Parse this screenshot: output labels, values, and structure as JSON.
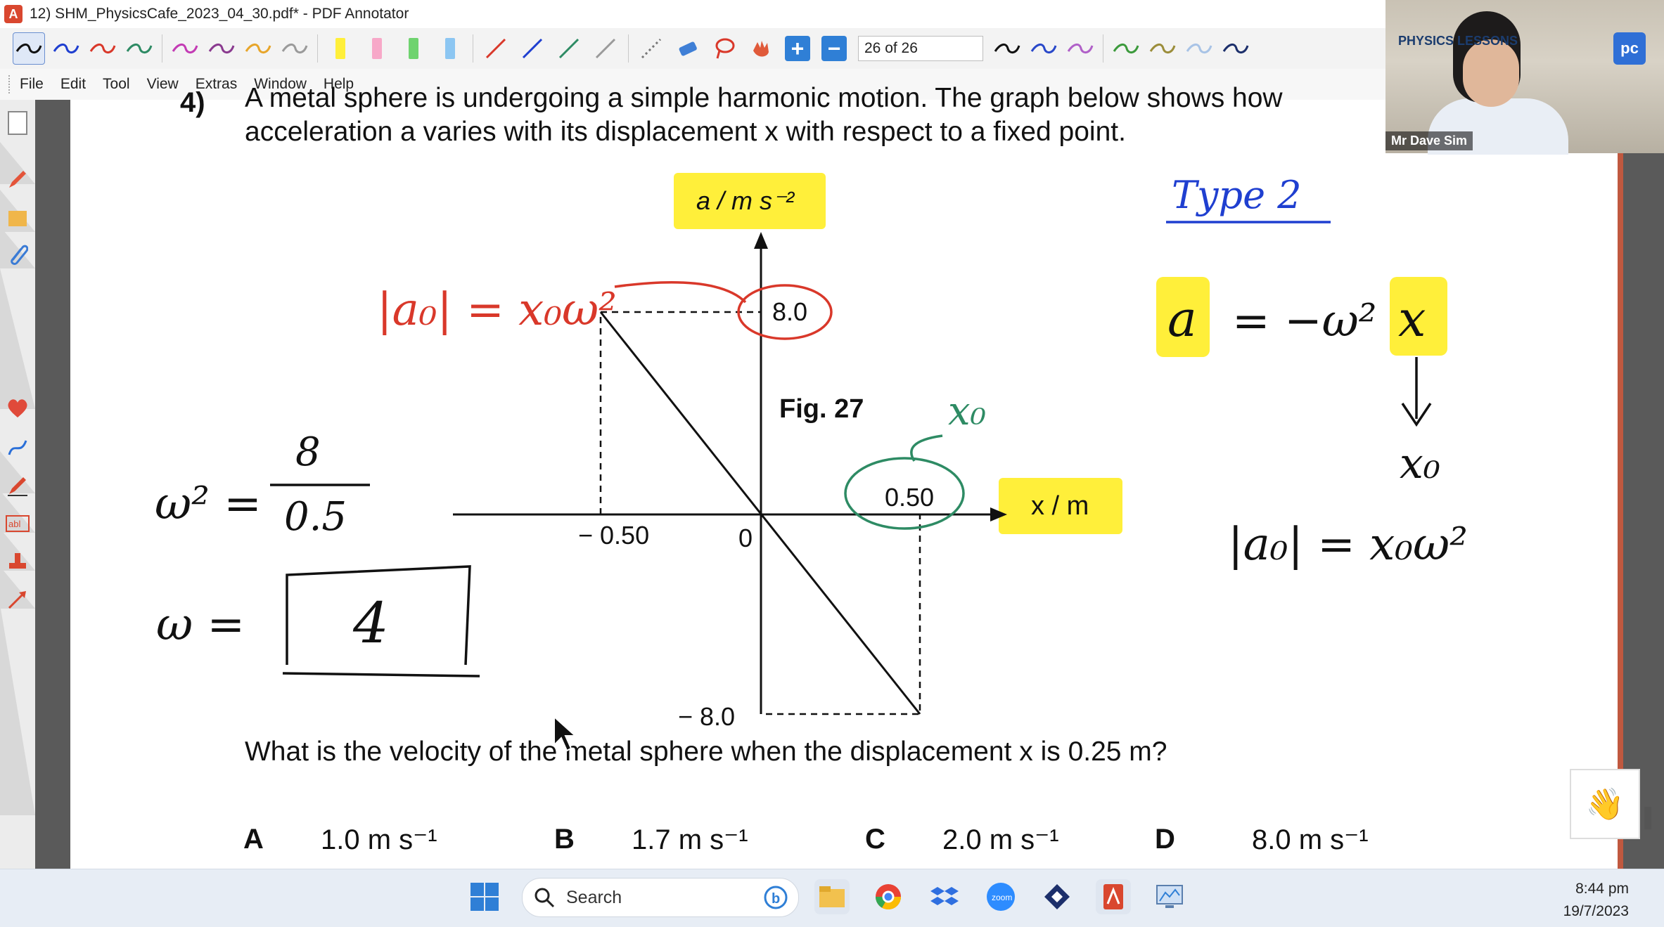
{
  "window": {
    "title": "12) SHM_PhysicsCafe_2023_04_30.pdf* - PDF Annotator"
  },
  "toolbar": {
    "page_indicator": "26 of 26",
    "zoom_in": "+",
    "zoom_out": "−"
  },
  "menu": [
    "File",
    "Edit",
    "Tool",
    "View",
    "Extras",
    "Window",
    "Help"
  ],
  "document": {
    "question_number": "4)",
    "question_line1": "A metal sphere is undergoing a simple harmonic motion. The graph below shows how",
    "question_line2": "acceleration a varies with its displacement x with respect to a fixed point.",
    "figure_caption": "Fig. 27",
    "y_axis_label": "a / m s⁻²",
    "x_axis_label": "x / m",
    "tick_y_top": "8.0",
    "tick_y_bottom": "− 8.0",
    "tick_x_left": "− 0.50",
    "tick_x_right": "0.50",
    "origin": "0",
    "question_bottom": "What is the velocity of the metal sphere when the displacement x is 0.25 m?",
    "options": [
      {
        "letter": "A",
        "value": "1.0 m s⁻¹"
      },
      {
        "letter": "B",
        "value": "1.7 m s⁻¹"
      },
      {
        "letter": "C",
        "value": "2.0 m s⁻¹"
      },
      {
        "letter": "D",
        "value": "8.0 m s⁻¹"
      }
    ]
  },
  "handwriting": {
    "red_formula": "|a₀| = x₀ω²",
    "green_label": "x₀",
    "omega_sq": "ω² =",
    "fraction_num": "8",
    "fraction_den": "0.5",
    "omega_eq": "ω =",
    "omega_value": "4",
    "type_label": "Type 2",
    "eq_a": "a",
    "eq_rest": "= −ω²",
    "eq_x": "x",
    "x0": "x₀",
    "abs_formula": "|a₀| = x₀ω²"
  },
  "webcam": {
    "name": "Mr Dave Sim",
    "logo_text": "PHYSICS LESSONS",
    "logo_badge": "pc"
  },
  "taskbar": {
    "search_label": "Search",
    "time": "8:44 pm",
    "date": "19/7/2023"
  },
  "colors": {
    "highlight_yellow": "#ffef3a",
    "ink_red": "#d9382a",
    "ink_green": "#2e8b64",
    "ink_blue": "#1f3fd0",
    "accent_blue": "#2f7fd6"
  }
}
